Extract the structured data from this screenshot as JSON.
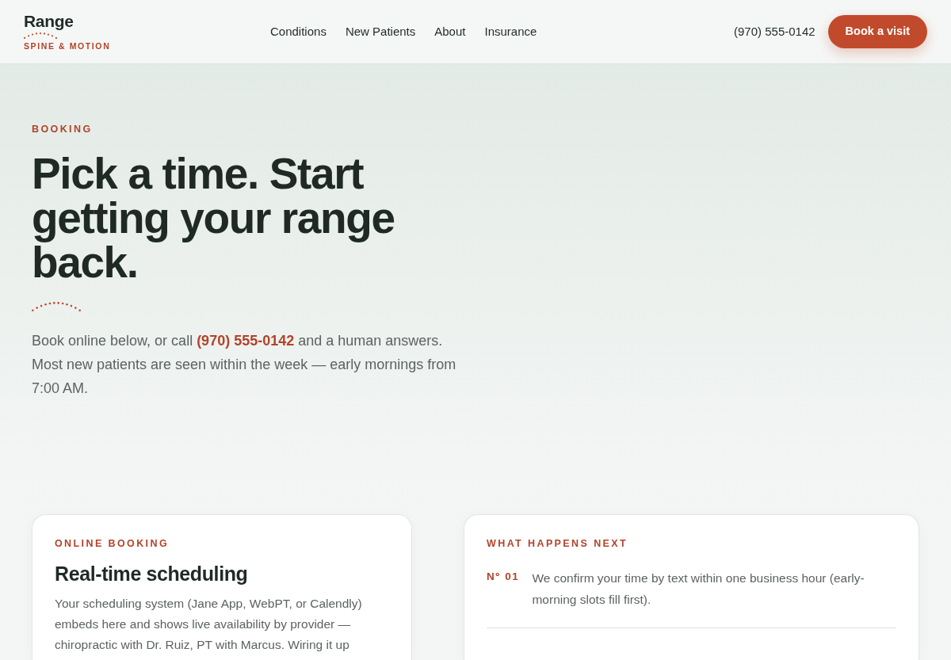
{
  "header": {
    "logo": {
      "name": "Range",
      "tagline": "SPINE & MOTION"
    },
    "nav": [
      {
        "label": "Conditions"
      },
      {
        "label": "New Patients"
      },
      {
        "label": "About"
      },
      {
        "label": "Insurance"
      }
    ],
    "phone": "(970) 555-0142",
    "cta": "Book a visit"
  },
  "hero": {
    "eyebrow": "BOOKING",
    "title": "Pick a time. Start getting your range back.",
    "intro": {
      "before": "Book online below, or call",
      "link": "(970) 555-0142",
      "after": "and a human answers. Most new patients are seen within the week — early mornings from 7:00 AM."
    }
  },
  "booking_card": {
    "eyebrow": "ONLINE BOOKING",
    "title": "Real-time scheduling",
    "text": "Your scheduling system (Jane App, WebPT, or Calendly) embeds here and shows live availability by provider — chiropractic with Dr. Ruiz, PT with Marcus. Wiring it up"
  },
  "next_card": {
    "eyebrow": "WHAT HAPPENS NEXT",
    "steps": [
      {
        "number": "Nº 01",
        "text": "We confirm your time by text within one business hour (early-morning slots fill first)."
      }
    ]
  }
}
